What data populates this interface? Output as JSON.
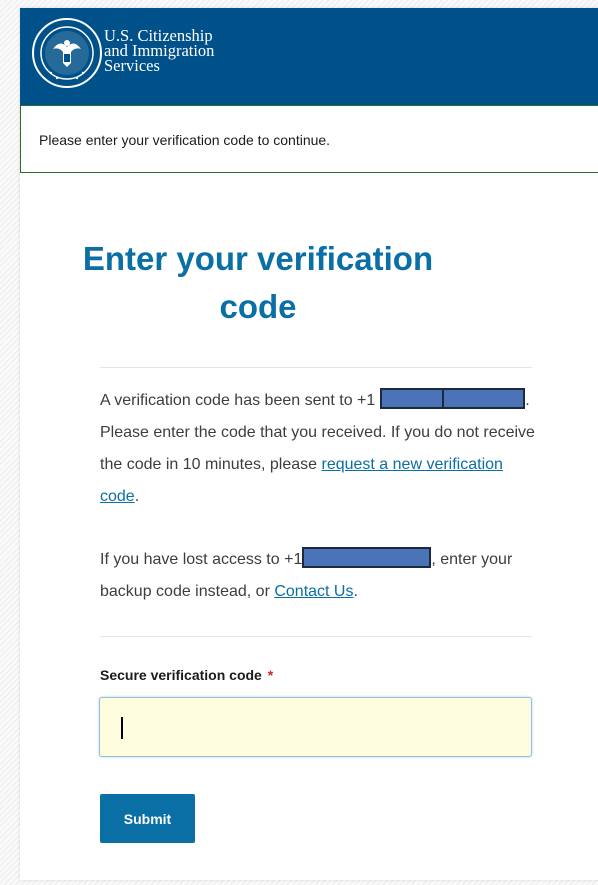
{
  "header": {
    "seal_icon": "dhs-seal-icon",
    "agency_name": [
      "U.S. Citizenship",
      "and Immigration",
      "Services"
    ]
  },
  "alert": {
    "message": "Please enter your verification code to continue."
  },
  "main": {
    "title_line1": "Enter your verification",
    "title_line2": "code",
    "sent_message": {
      "text_before_number": "A verification code has been sent to +1",
      "text_after_number": ". Please enter the code that you received. If you do not receive the code in 10 minutes, please",
      "request_link": "request a new verification code",
      "trailing": "."
    },
    "lost_access": {
      "text_before_number": "If you have lost access to +1",
      "text_after_number": ", enter your backup code instead, or",
      "contact_link": "Contact Us",
      "trailing": "."
    },
    "code_field": {
      "label": "Secure verification code",
      "required_marker": "*",
      "value": ""
    },
    "submit_label": "Submit"
  },
  "colors": {
    "header_bg": "#005189",
    "title": "#0a6fa4",
    "link": "#0a6fa4",
    "button_bg": "#0a6fa4",
    "input_bg": "#fefde0",
    "alert_border": "#2e6b2e",
    "redaction_fill": "#4a74b7",
    "required": "#c9272a"
  }
}
